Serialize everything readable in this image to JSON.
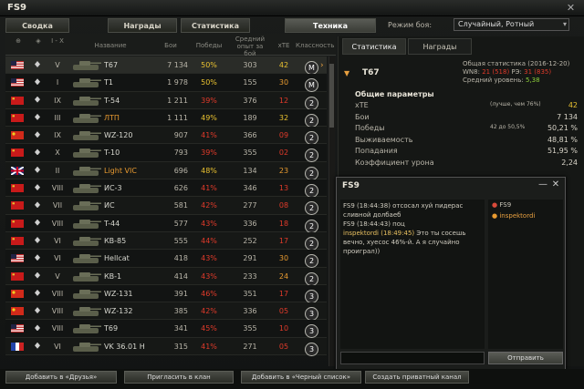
{
  "window": {
    "title": "FS9",
    "close": "✕"
  },
  "tabs": [
    "Сводка",
    "Награды",
    "Статистика",
    "Техника"
  ],
  "battle_mode": {
    "label": "Режим боя:",
    "value": "Случайный, Ротный"
  },
  "columns": {
    "lvl": "I - X",
    "name": "Название",
    "battles": "Бои",
    "wins": "Победы",
    "avg_xp": "Средний опыт за бой",
    "xte": "хТЕ",
    "class": "Классность"
  },
  "colors": {
    "green": "#8ecf3a",
    "red": "#e03a2a",
    "yellow": "#e8c030",
    "orange": "#e89a30",
    "white": "#d8d8d0",
    "gold": "#e8a040"
  },
  "vehicles": [
    {
      "flag": "usa",
      "lvl": "V",
      "name": "T67",
      "battles": "7 134",
      "wins": "50%",
      "wc": "yellow",
      "xp": "303",
      "xte": "42",
      "xc": "yellow",
      "badge": "M",
      "sel": true
    },
    {
      "flag": "usa",
      "lvl": "I",
      "name": "T1",
      "battles": "1 978",
      "wins": "50%",
      "wc": "yellow",
      "xp": "155",
      "xte": "30",
      "xc": "orange",
      "badge": "M"
    },
    {
      "flag": "ussr",
      "lvl": "IX",
      "name": "T-54",
      "battles": "1 211",
      "wins": "39%",
      "wc": "red",
      "xp": "376",
      "xte": "12",
      "xc": "red",
      "badge": "2"
    },
    {
      "flag": "ussr",
      "lvl": "III",
      "name": "ЛТП",
      "battles": "1 111",
      "wins": "49%",
      "wc": "yellow",
      "xp": "189",
      "xte": "32",
      "xc": "yellow",
      "badge": "2",
      "nc": "orange"
    },
    {
      "flag": "china",
      "lvl": "IX",
      "name": "WZ-120",
      "battles": "907",
      "wins": "41%",
      "wc": "red",
      "xp": "366",
      "xte": "09",
      "xc": "red",
      "badge": "2"
    },
    {
      "flag": "ussr",
      "lvl": "X",
      "name": "T-10",
      "battles": "793",
      "wins": "39%",
      "wc": "red",
      "xp": "355",
      "xte": "02",
      "xc": "red",
      "badge": "2"
    },
    {
      "flag": "uk",
      "lvl": "II",
      "name": "Light VIC",
      "battles": "696",
      "wins": "48%",
      "wc": "yellow",
      "xp": "134",
      "xte": "23",
      "xc": "orange",
      "badge": "2",
      "nc": "orange"
    },
    {
      "flag": "ussr",
      "lvl": "VIII",
      "name": "ИС-3",
      "battles": "626",
      "wins": "41%",
      "wc": "red",
      "xp": "346",
      "xte": "13",
      "xc": "red",
      "badge": "2"
    },
    {
      "flag": "ussr",
      "lvl": "VII",
      "name": "ИС",
      "battles": "581",
      "wins": "42%",
      "wc": "red",
      "xp": "277",
      "xte": "08",
      "xc": "red",
      "badge": "2"
    },
    {
      "flag": "ussr",
      "lvl": "VIII",
      "name": "T-44",
      "battles": "577",
      "wins": "43%",
      "wc": "red",
      "xp": "336",
      "xte": "18",
      "xc": "red",
      "badge": "2"
    },
    {
      "flag": "ussr",
      "lvl": "VI",
      "name": "КВ-85",
      "battles": "555",
      "wins": "44%",
      "wc": "red",
      "xp": "252",
      "xte": "17",
      "xc": "red",
      "badge": "2"
    },
    {
      "flag": "usa",
      "lvl": "VI",
      "name": "Hellcat",
      "battles": "418",
      "wins": "43%",
      "wc": "red",
      "xp": "291",
      "xte": "30",
      "xc": "orange",
      "badge": "2"
    },
    {
      "flag": "ussr",
      "lvl": "V",
      "name": "КВ-1",
      "battles": "414",
      "wins": "43%",
      "wc": "red",
      "xp": "233",
      "xte": "24",
      "xc": "orange",
      "badge": "2"
    },
    {
      "flag": "china",
      "lvl": "VIII",
      "name": "WZ-131",
      "battles": "391",
      "wins": "46%",
      "wc": "red",
      "xp": "351",
      "xte": "17",
      "xc": "red",
      "badge": "3"
    },
    {
      "flag": "china",
      "lvl": "VIII",
      "name": "WZ-132",
      "battles": "385",
      "wins": "42%",
      "wc": "red",
      "xp": "336",
      "xte": "05",
      "xc": "red",
      "badge": "3"
    },
    {
      "flag": "usa",
      "lvl": "VIII",
      "name": "T69",
      "battles": "341",
      "wins": "45%",
      "wc": "red",
      "xp": "355",
      "xte": "10",
      "xc": "red",
      "badge": "3"
    },
    {
      "flag": "france",
      "lvl": "VI",
      "name": "VK 36.01 H",
      "battles": "315",
      "wins": "41%",
      "wc": "red",
      "xp": "271",
      "xte": "05",
      "xc": "red",
      "badge": "3"
    }
  ],
  "right": {
    "tabs": [
      "Статистика",
      "Награды"
    ],
    "vehicle": "T67",
    "general_title": "Общая статистика (2016-12-20)",
    "wn8_label": "WN8:",
    "wn8": "21 (518)",
    "r3_label": "РЭ:",
    "r3": "31 (835)",
    "avg_lvl_label": "Средний уровень:",
    "avg_lvl": "5,38",
    "section": "Общие параметры",
    "params": [
      {
        "k": "xTE",
        "mid": "(лучше, чем 76%)",
        "v": "42",
        "vc": "yellow"
      },
      {
        "k": "Бои",
        "v": "7 134"
      },
      {
        "k": "Победы",
        "mid": "42 до 50,5%",
        "v": "50,21 %"
      },
      {
        "k": "Выживаемость",
        "v": "48,81 %"
      },
      {
        "k": "Попадания",
        "v": "51,95 %"
      },
      {
        "k": "Коэффициент урона",
        "v": "2,24"
      }
    ]
  },
  "chat": {
    "title": "FS9",
    "min": "—",
    "close": "✕",
    "log": [
      {
        "text": "FS9 (18:44:38) отсосал хуй пидерас сливной долбаеб"
      },
      {
        "text": "FS9 (18:44:43) поц"
      },
      {
        "name": "inspektordi (18:49:45)",
        "text": " Это ты сосешь вечно, хуесос 46%-й. А я случайно проиграл))"
      }
    ],
    "users": [
      "FS9",
      "inspektordi"
    ],
    "send": "Отправить"
  },
  "bottom": [
    "Добавить в «Друзья»",
    "Пригласить в клан",
    "Добавить в «Черный список»",
    "Создать приватный канал"
  ]
}
